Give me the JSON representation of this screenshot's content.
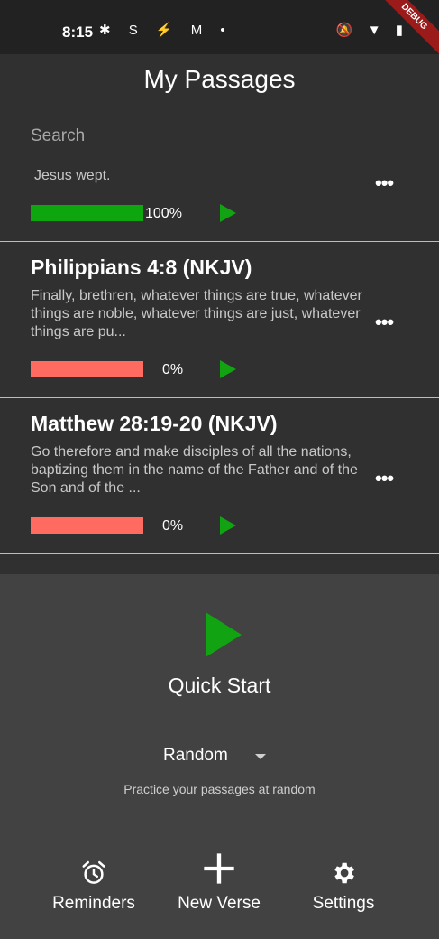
{
  "status_bar": {
    "time": "8:15",
    "debug_label": "DEBUG"
  },
  "app_bar": {
    "title": "My Passages"
  },
  "search": {
    "placeholder": "Search"
  },
  "passages": [
    {
      "title": "",
      "text": "Jesus wept.",
      "progress": 100,
      "progress_label": "100%",
      "bar_color": "#0ea60e"
    },
    {
      "title": "Philippians 4:8 (NKJV)",
      "text": "Finally, brethren, whatever things are true, whatever things are noble, whatever things are just, whatever things are pu...",
      "progress": 0,
      "progress_label": "0%",
      "bar_color": "#ff6b61"
    },
    {
      "title": "Matthew 28:19-20 (NKJV)",
      "text": "Go therefore and  make disciples of all the nations, baptizing them in the name of the Father and of the Son and of the ...",
      "progress": 0,
      "progress_label": "0%",
      "bar_color": "#ff6b61"
    }
  ],
  "quick_start": {
    "label": "Quick Start",
    "mode": "Random",
    "hint": "Practice your passages at random"
  },
  "bottom_nav": [
    {
      "label": "Reminders",
      "icon": "alarm-clock-icon"
    },
    {
      "label": "New Verse",
      "icon": "plus-icon"
    },
    {
      "label": "Settings",
      "icon": "gear-icon"
    }
  ],
  "colors": {
    "accent_green": "#11a311",
    "progress_full": "#0ea60e",
    "progress_empty": "#ff6b61",
    "background": "#303030",
    "panel": "#424242"
  }
}
